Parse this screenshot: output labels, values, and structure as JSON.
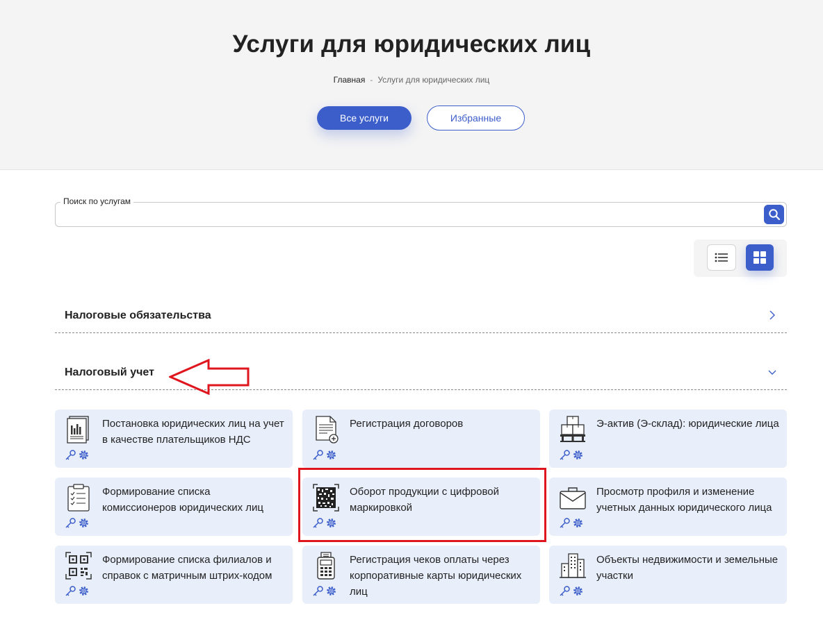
{
  "header": {
    "title": "Услуги для юридических лиц",
    "breadcrumb_home": "Главная",
    "breadcrumb_sep": "-",
    "breadcrumb_current": "Услуги для юридических лиц",
    "tab_all": "Все услуги",
    "tab_favorites": "Избранные"
  },
  "search": {
    "label": "Поиск по услугам",
    "value": "",
    "placeholder": ""
  },
  "view": {
    "active": "grid"
  },
  "categories": [
    {
      "title": "Налоговые обязательства",
      "state": "collapsed"
    },
    {
      "title": "Налоговый учет",
      "state": "expanded"
    }
  ],
  "services": [
    {
      "label": "Постановка юридических лиц на учет в качестве плательщиков НДС",
      "icon": "tax-document-icon"
    },
    {
      "label": "Регистрация договоров",
      "icon": "contract-add-icon"
    },
    {
      "label": "Э-актив (Э-склад): юридические лица",
      "icon": "warehouse-icon"
    },
    {
      "label": "Формирование списка комиссионеров юридических лиц",
      "icon": "checklist-icon"
    },
    {
      "label": "Оборот продукции с цифровой маркировкой",
      "icon": "datamatrix-icon"
    },
    {
      "label": "Просмотр профиля и изменение учетных данных юридического лица",
      "icon": "briefcase-icon"
    },
    {
      "label": "Формирование списка филиалов и справок с матричным штрих-кодом",
      "icon": "qr-code-icon"
    },
    {
      "label": "Регистрация чеков оплаты через корпоративные карты юридических лиц",
      "icon": "pos-terminal-icon"
    },
    {
      "label": "Объекты недвижимости и земельные участки",
      "icon": "buildings-icon"
    }
  ],
  "annotation": {
    "arrow_color": "#e0161e",
    "highlight_color": "#e0161e"
  },
  "colors": {
    "accent": "#3c5ecb",
    "card_bg": "#e8eefa",
    "hero_bg": "#f4f4f4"
  }
}
